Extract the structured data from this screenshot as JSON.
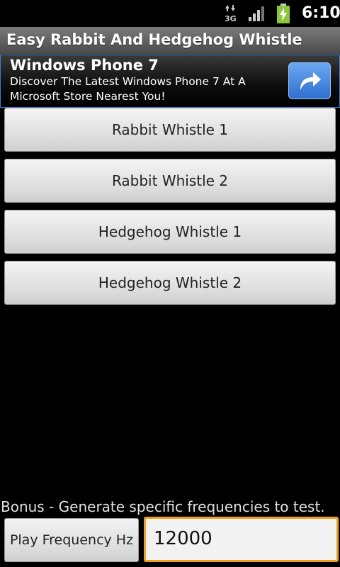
{
  "status_bar": {
    "network": "3G",
    "time": "6:10"
  },
  "title_bar": {
    "title": "Easy Rabbit And Hedgehog Whistle"
  },
  "ad": {
    "title": "Windows Phone 7",
    "text": "Discover The Latest Windows Phone 7 At A Microsoft Store Nearest You!",
    "button_icon": "share-arrow-icon"
  },
  "buttons": [
    {
      "label": "Rabbit Whistle 1"
    },
    {
      "label": "Rabbit Whistle 2"
    },
    {
      "label": "Hedgehog Whistle 1"
    },
    {
      "label": "Hedgehog Whistle 2"
    }
  ],
  "bonus": {
    "label": "Bonus - Generate specific frequencies to test.",
    "play_button_label": "Play Frequency Hz",
    "frequency_value": "12000"
  },
  "colors": {
    "input_focus": "#f0a020",
    "ad_border": "#3f7fd0"
  }
}
